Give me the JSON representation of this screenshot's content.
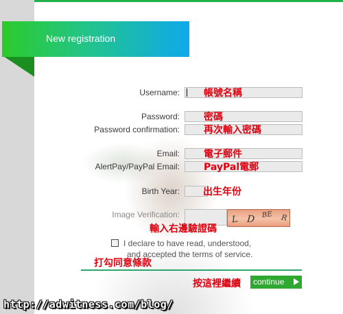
{
  "banner": {
    "title": "New registration"
  },
  "fields": {
    "username": {
      "label": "Username:",
      "annotation": "帳號名稱"
    },
    "password": {
      "label": "Password:",
      "annotation": "密碼"
    },
    "password_confirmation": {
      "label": "Password confirmation:",
      "annotation": "再次輸入密碼"
    },
    "email": {
      "label": "Email:",
      "annotation": "電子郵件"
    },
    "paypal_email": {
      "label": "AlertPay/PayPal Email:",
      "annotation_prefix": "PayPal",
      "annotation_suffix": "電郵"
    },
    "birth_year": {
      "label": "Birth Year:",
      "annotation": "出生年份"
    },
    "image_verification": {
      "label": "Image Verification:",
      "annotation": "輸入右邊驗證碼"
    }
  },
  "captcha": {
    "chars": [
      "L",
      "D",
      "BE",
      "R"
    ]
  },
  "terms": {
    "line1": "I declare to have read, understood,",
    "line2": "and accepted the terms of service.",
    "annotation": "打勾同意條款",
    "checked": false
  },
  "continue": {
    "label": "continue",
    "annotation": "按這裡繼續"
  },
  "watermark": "http://adwitness.com/blog/",
  "colors": {
    "banner_start": "#2ccb2b",
    "banner_end": "#0fa9ec",
    "annotation_red": "#e0000f",
    "continue_green": "#2fa82f"
  }
}
